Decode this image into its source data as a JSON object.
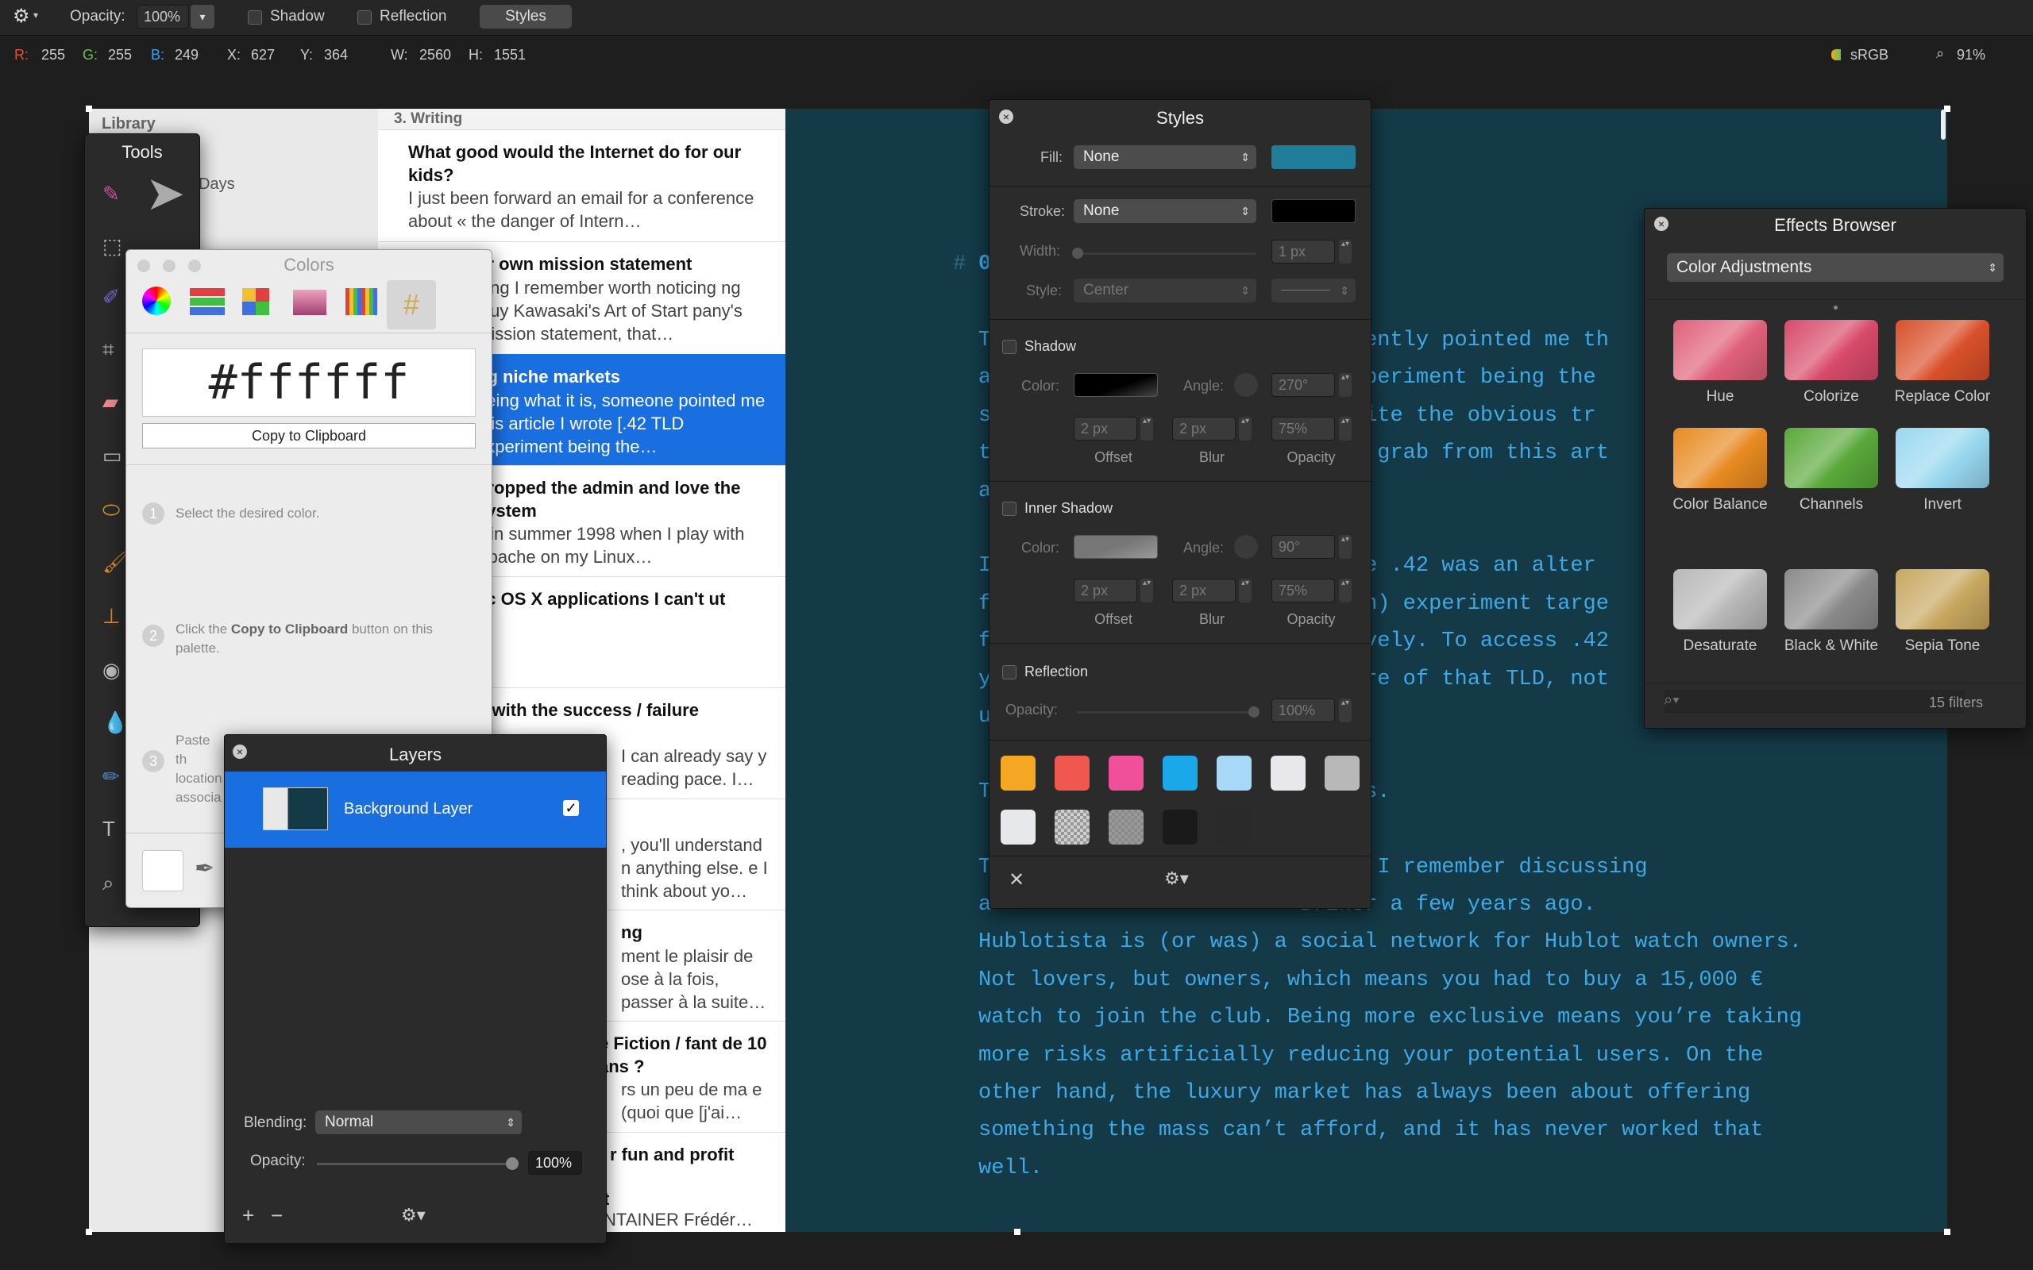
{
  "toolbar": {
    "opacity_label": "Opacity:",
    "opacity_value": "100%",
    "shadow_label": "Shadow",
    "reflection_label": "Reflection",
    "styles_label": "Styles"
  },
  "infobar": {
    "r_label": "R:",
    "r_value": "255",
    "g_label": "G:",
    "g_value": "255",
    "b_label": "B:",
    "b_value": "249",
    "x_label": "X:",
    "x_value": "627",
    "y_label": "Y:",
    "y_value": "364",
    "w_label": "W:",
    "w_value": "2560",
    "h_label": "H:",
    "h_value": "1551",
    "colorspace": "sRGB",
    "zoom": "91%"
  },
  "library": {
    "title": "Library",
    "days": "Days",
    "section": "3. Writing"
  },
  "list": [
    {
      "title": "What good would the Internet do for our kids?",
      "body": "I just been forward an email for a conference about « the danger of Intern…"
    },
    {
      "title": "ur own mission statement",
      "body": "hing I remember worth noticing ng Guy Kawasaki's Art of Start pany's mission statement, that…"
    },
    {
      "title": "ng niche markets",
      "body": "being what it is, someone pointed me this article I wrote [.42 TLD experiment being the…"
    },
    {
      "title": "dropped the admin and love the system",
      "body": "s in summer 1998 when I play with Apache on my Linux…"
    },
    {
      "title": "ac OS X applications I can't ut",
      "body": ""
    },
    {
      "title": "o with the success / failure",
      "body": "I can already say y reading pace. I…"
    },
    {
      "title": "",
      "body": ", you'll understand n anything else. e I think about yo…"
    },
    {
      "title": "ng",
      "body": "ment le plaisir de ose à la fois, passer à la suite…"
    },
    {
      "title": "e Fiction / fant de 10 ans ?",
      "body": "rs un peu de ma e (quoi que [j'ai…"
    },
    {
      "title": "r fun and profit",
      "body": ""
    },
    {
      "title": "t",
      "body": "NTAINER Frédér…"
    }
  ],
  "editor": {
    "lines": [
      "T                        e recently pointed me th",
      "a                        LD experiment being the",
      "s                         Despite the obvious tr",
      "t                        ed to grab from this art",
      "a",
      "",
      "I                        t, the .42 was an alter",
      "f                        Domain) experiment targe",
      "f                        clusively. To access .42",
      "y                        s aware of that TLD, not",
      "u",
      "",
      "T                        arkets.",
      "",
      "T                        ople. I remember discussing",
      "a                        Briner a few years ago.",
      "Hublotista is (or was) a social network for Hublot watch owners.",
      "Not lovers, but owners, which means you had to buy a 15,000 €",
      "watch to join the club. Being more exclusive means you’re taking",
      "more risks artificially reducing your potential users. On the",
      "other hand, the luxury market has always been about offering",
      "something the mass can’t afford, and it has never worked that",
      "well."
    ]
  },
  "tools": {
    "title": "Tools"
  },
  "colors": {
    "title": "Colors",
    "hex": "#ffffff",
    "copy_button": "Copy to Clipboard",
    "step1": "Select the desired color.",
    "step2_pre": "Click the ",
    "step2_bold": "Copy to Clipboard",
    "step2_post": " button on this palette.",
    "step3": "Paste th location associa"
  },
  "layers": {
    "title": "Layers",
    "layer_name": "Background Layer",
    "blending_label": "Blending:",
    "blending_value": "Normal",
    "opacity_label": "Opacity:",
    "opacity_value": "100%"
  },
  "styles": {
    "title": "Styles",
    "fill_label": "Fill:",
    "fill_value": "None",
    "fill_color": "#1f7d9a",
    "stroke_label": "Stroke:",
    "stroke_value": "None",
    "stroke_color": "#000000",
    "width_label": "Width:",
    "width_value": "1 px",
    "style_label": "Style:",
    "style_value": "Center",
    "shadow_title": "Shadow",
    "color_label": "Color:",
    "angle_label": "Angle:",
    "shadow_angle": "270°",
    "shadow_offset": "2 px",
    "shadow_blur": "2 px",
    "shadow_opacity": "75%",
    "offset_label": "Offset",
    "blur_label": "Blur",
    "opacity_label": "Opacity",
    "inner_title": "Inner Shadow",
    "inner_angle": "90°",
    "inner_offset": "2 px",
    "inner_blur": "2 px",
    "inner_opacity": "75%",
    "reflection_title": "Reflection",
    "reflection_opacity_label": "Opacity:",
    "reflection_opacity": "100%",
    "swatch_colors": [
      "#f5a623",
      "#f0584f",
      "#f0509a",
      "#1aa8ea",
      "#a8d8f8",
      "#e8e8ec",
      "#b8b8b8",
      "#e6e8ec",
      "#cfcfcf",
      "#8a8a8a",
      "#1a1a1a",
      "#2a2a2a"
    ]
  },
  "effects": {
    "title": "Effects Browser",
    "category": "Color Adjustments",
    "filters_count": "15 filters",
    "items": [
      {
        "name": "Hue",
        "color": "#e0607a"
      },
      {
        "name": "Colorize",
        "color": "#d84a6a"
      },
      {
        "name": "Replace Color",
        "color": "#d8502a"
      },
      {
        "name": "Color Balance",
        "color": "#e88a20"
      },
      {
        "name": "Channels",
        "color": "#5aa83a"
      },
      {
        "name": "Invert",
        "color": "#9ad8f0"
      },
      {
        "name": "Desaturate",
        "color": "#b8b8b8"
      },
      {
        "name": "Black & White",
        "color": "#8a8a8a"
      },
      {
        "name": "Sepia Tone",
        "color": "#c8a860"
      }
    ]
  }
}
